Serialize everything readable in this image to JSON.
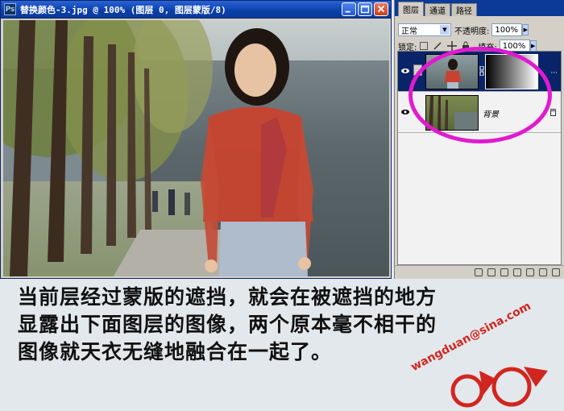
{
  "document_window": {
    "title": "替换颜色-3.jpg @ 100% (图层 0, 图层蒙版/8)",
    "app_icon": "Ps",
    "controls": [
      "minimize-icon",
      "maximize-icon",
      "close-icon"
    ]
  },
  "layers_panel": {
    "tabs": [
      {
        "label": "图层",
        "active": true
      },
      {
        "label": "通道",
        "active": false
      },
      {
        "label": "路径",
        "active": false
      }
    ],
    "blend_mode": "正常",
    "opacity_label": "不透明度:",
    "opacity_value": "100%",
    "lock_label": "锁定:",
    "fill_label": "填充:",
    "fill_value": "100%",
    "layers": [
      {
        "name": "",
        "has_mask": true,
        "selected": true,
        "visible": true
      },
      {
        "name": "背景",
        "has_mask": false,
        "selected": false,
        "visible": true,
        "locked": true
      }
    ]
  },
  "caption": {
    "line1": "当前层经过蒙版的遮挡，就会在被遮挡的地方",
    "line2": "显露出下面图层的图像，两个原本毫不相干的",
    "line3": "图像就天衣无缝地融合在一起了。"
  },
  "watermark": {
    "text": "wangduan@sina.com"
  },
  "colors": {
    "titlebar": "#0b3a98",
    "highlight": "#e11ad0",
    "watermark": "#d1261f"
  }
}
